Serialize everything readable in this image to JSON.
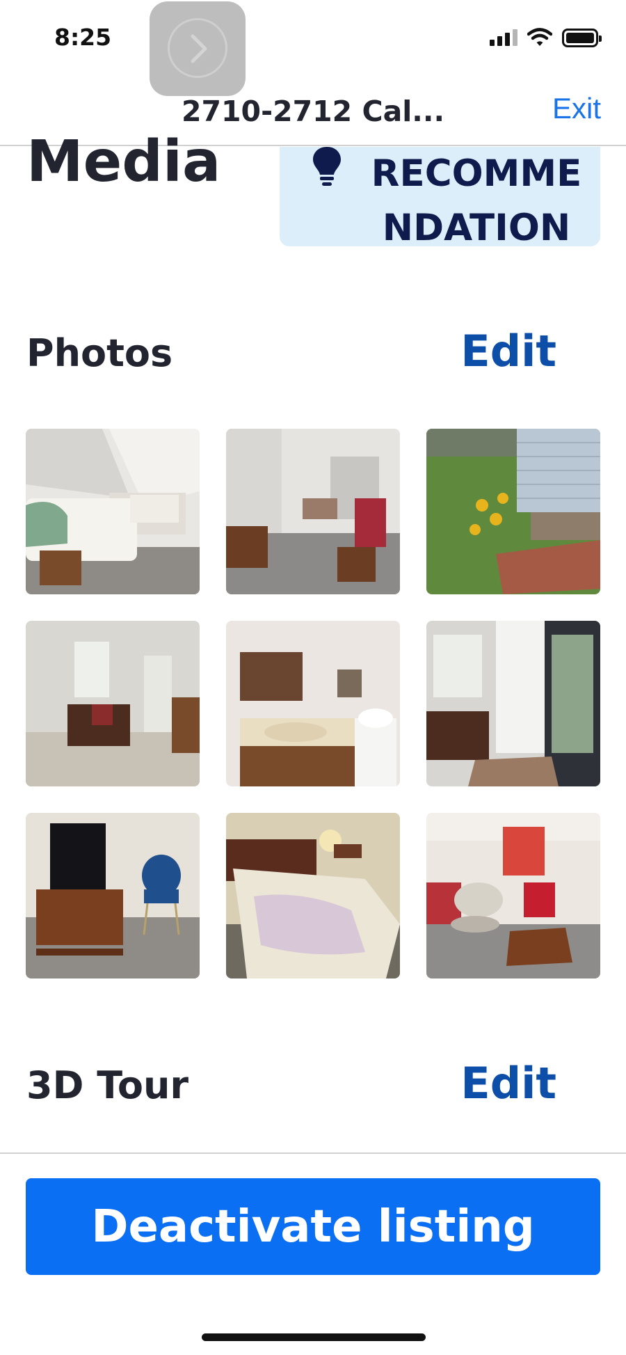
{
  "status_bar": {
    "time": "8:25",
    "icons": [
      "back-to-app-icon",
      "cellular-signal-icon",
      "wifi-icon",
      "battery-icon"
    ]
  },
  "nav": {
    "title": "2710-2712 Cal...",
    "exit_label": "Exit"
  },
  "media": {
    "title": "Media",
    "recommendation_label": "RECOMMENDATION",
    "recommendation_icon": "lightbulb-icon"
  },
  "photos": {
    "title": "Photos",
    "edit_label": "Edit",
    "items": [
      {
        "subject": "attic bedroom with two beds"
      },
      {
        "subject": "living room with red chair"
      },
      {
        "subject": "garden with yellow flowers"
      },
      {
        "subject": "dining area with door"
      },
      {
        "subject": "bathroom with sink and toilet"
      },
      {
        "subject": "dining area with glass door"
      },
      {
        "subject": "tv stand and blue chair"
      },
      {
        "subject": "bedroom with floral bedspread"
      },
      {
        "subject": "living room with red lamp"
      }
    ]
  },
  "tour": {
    "title": "3D Tour",
    "edit_label": "Edit"
  },
  "footer": {
    "deactivate_label": "Deactivate listing"
  },
  "colors": {
    "accent_blue": "#0b6ff3",
    "edit_blue": "#0d4fa8",
    "exit_blue": "#1a73e8",
    "recommendation_bg": "#ddeefb",
    "recommendation_text": "#0f1b4d",
    "heading_text": "#222430"
  }
}
